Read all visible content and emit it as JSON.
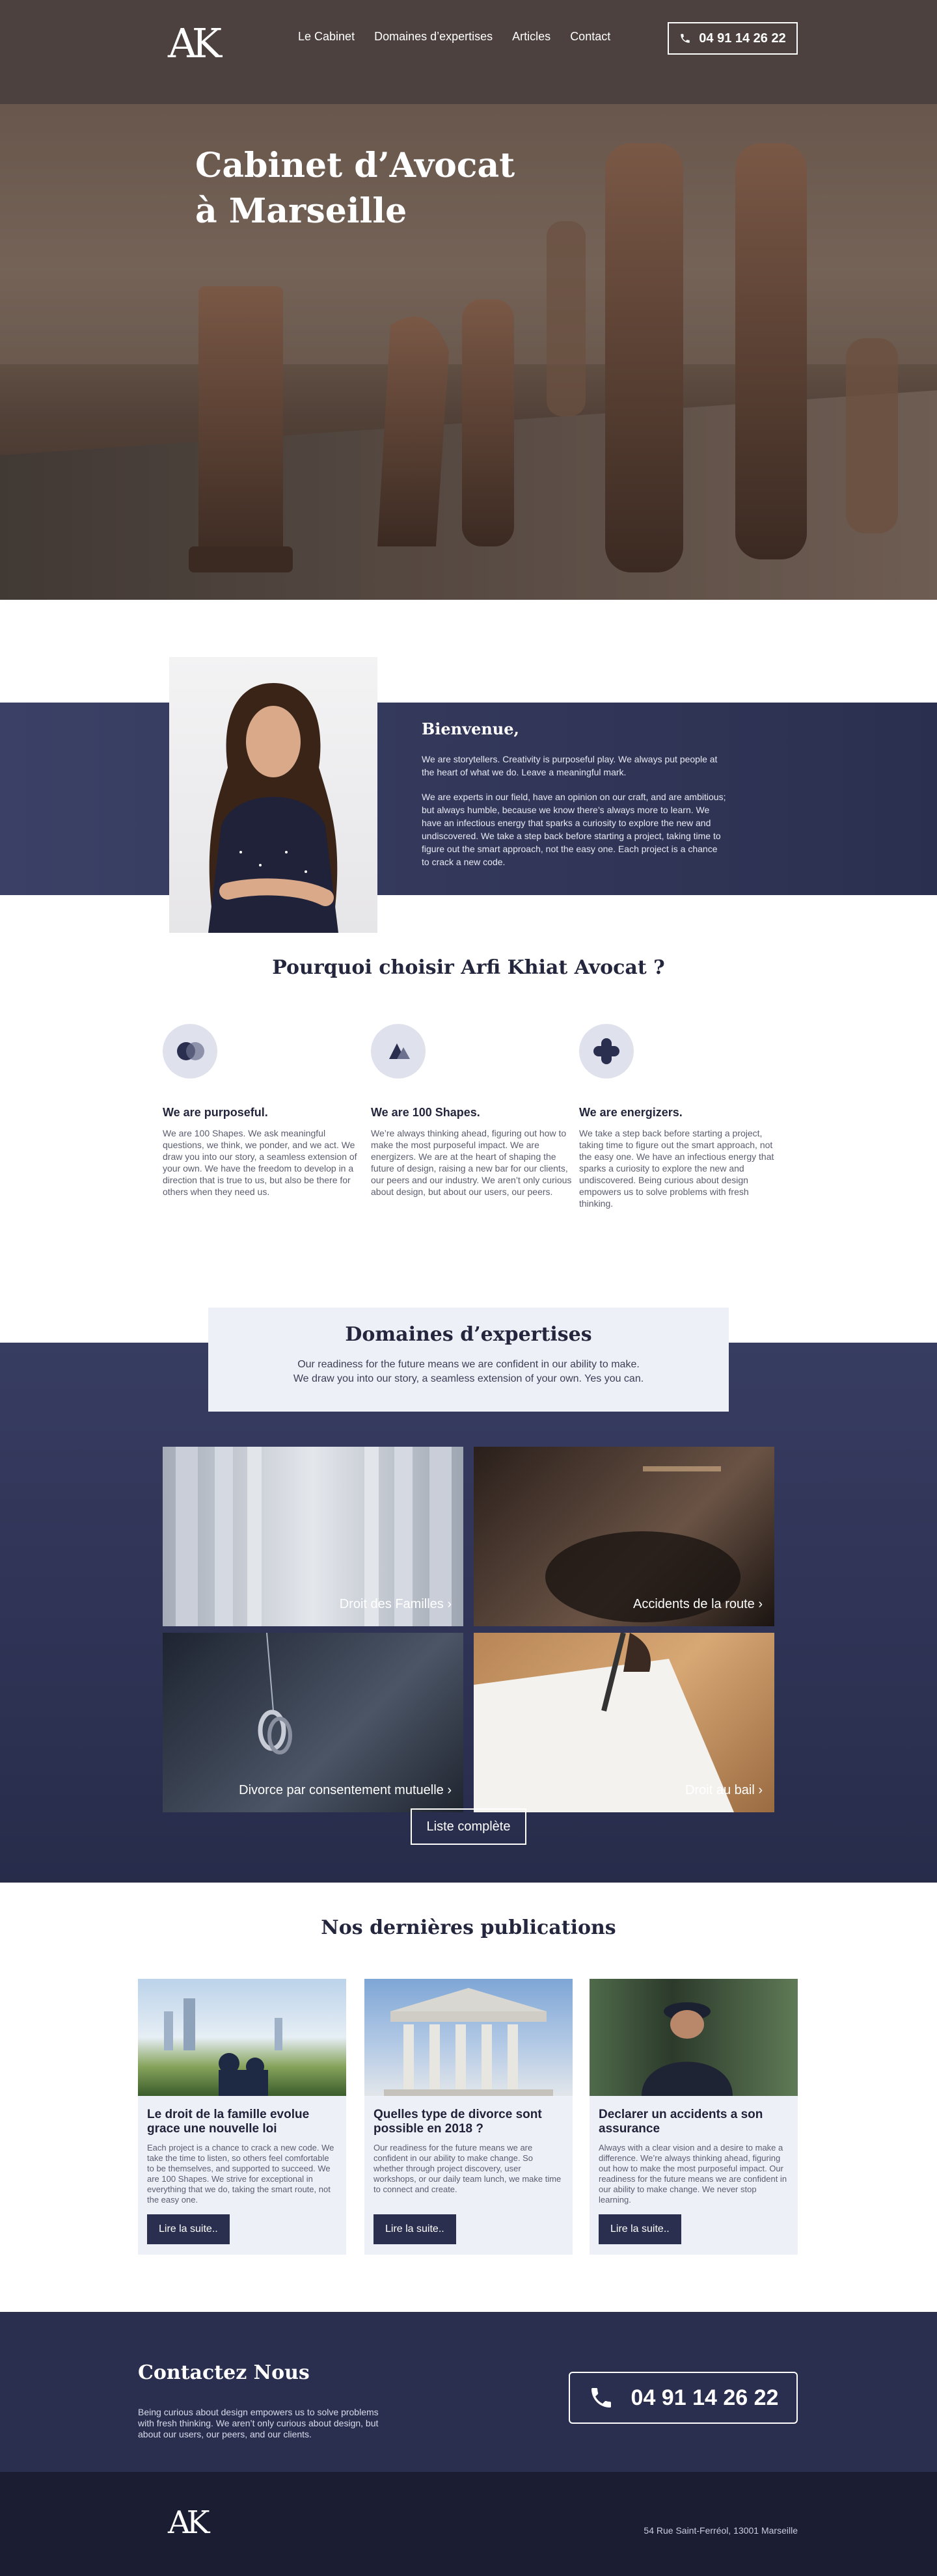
{
  "brand": {
    "logo": "AK"
  },
  "nav": {
    "links": [
      "Le Cabinet",
      "Domaines d’expertises",
      "Articles",
      "Contact"
    ],
    "phone": "04 91 14 26 22"
  },
  "hero": {
    "title_line1": "Cabinet d’Avocat",
    "title_line2": "à Marseille"
  },
  "welcome": {
    "heading": "Bienvenue,",
    "p1": "We are storytellers. Creativity is purposeful play. We always put people at the heart of what we do. Leave a meaningful mark.",
    "p2": "We are experts in our field, have an opinion on our craft, and are ambitious; but always humble, because we know there’s always more to learn. We have an infectious energy that sparks a curiosity to explore the new and undiscovered. We take a step back before starting a project, taking time to figure out the smart approach, not the easy one. Each project is a chance to crack a new code."
  },
  "why": {
    "heading": "Pourquoi choisir Arfi Khiat Avocat ?",
    "features": [
      {
        "title": "We are purposeful.",
        "text": "We are 100 Shapes. We ask meaningful questions, we think, we ponder, and we act. We draw you into our story, a seamless extension of your own. We have the freedom to develop in a direction that is true to us, but also be there for others when they need us."
      },
      {
        "title": "We are 100 Shapes.",
        "text": "We’re always thinking ahead, figuring out how to make the most purposeful impact. We are energizers. We are at the heart of shaping the future of design, raising a new bar for our clients, our peers and our industry. We aren’t only curious about design, but about our users, our peers."
      },
      {
        "title": "We are energizers.",
        "text": "We take a step back before starting a project, taking time to figure out the smart approach, not the easy one. We have an infectious energy that sparks a curiosity to explore the new and undiscovered. Being curious about design empowers us to solve problems with fresh thinking."
      }
    ]
  },
  "domains": {
    "heading": "Domaines d’expertises",
    "text_line1": "Our readiness for the future means we are confident in our ability to make.",
    "text_line2": "We draw you into our story, a seamless extension of your own. Yes you can.",
    "tiles": [
      "Droit des Familles ›",
      "Accidents de la route ›",
      "Divorce par consentement mutuelle ›",
      "Droit au bail ›"
    ],
    "list_button": "Liste complète"
  },
  "pubs": {
    "heading": "Nos dernières publications",
    "cards": [
      {
        "title": "Le droit de la famille evolue grace une nouvelle loi",
        "text": "Each project is a chance to crack a new code. We take the time to listen, so others feel comfortable to be themselves, and supported to succeed. We are 100 Shapes. We strive for exceptional in everything that we do, taking the smart route, not the easy one.",
        "button": "Lire la suite.."
      },
      {
        "title": "Quelles type de divorce sont possible en 2018 ?",
        "text": "Our readiness for the future means we are confident in our ability to make change. So whether through project discovery, user workshops, or our daily team lunch, we make time to connect and create.",
        "button": "Lire la suite.."
      },
      {
        "title": "Declarer un accidents a son assurance",
        "text": "Always with a clear vision and a desire to make a difference. We’re always thinking ahead, figuring out how to make the most purposeful impact. Our readiness for the future means we are confident in our ability to make change. We never stop learning.",
        "button": "Lire la suite.."
      }
    ]
  },
  "contact": {
    "heading": "Contactez Nous",
    "text": "Being curious about design empowers us to solve problems with fresh thinking. We aren’t only curious about design, but about our users, our peers, and our clients.",
    "phone": "04 91 14 26 22"
  },
  "footer": {
    "logo": "AK",
    "address": "54 Rue Saint-Ferréol, 13001 Marseille"
  }
}
